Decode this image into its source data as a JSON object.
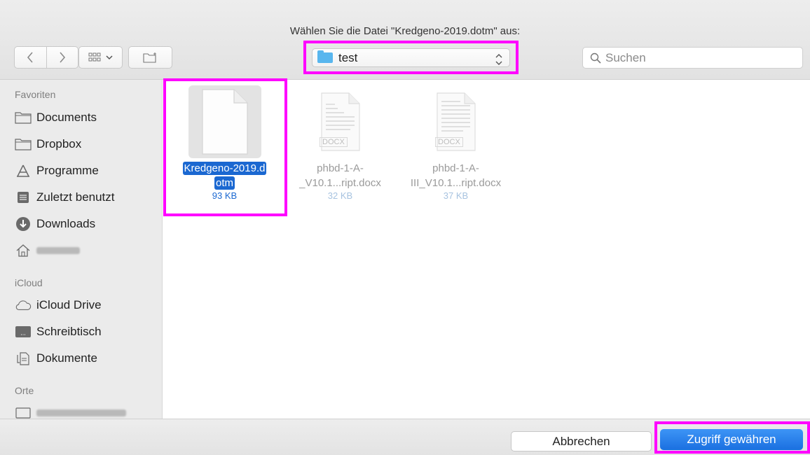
{
  "dialog": {
    "title": "Wählen Sie die Datei \"Kredgeno-2019.dotm\" aus:"
  },
  "toolbar": {
    "back_icon": "chevron-left-icon",
    "forward_icon": "chevron-right-icon",
    "view_icon": "icon-grid-view-icon",
    "new_folder_icon": "new-folder-icon",
    "location": "test",
    "search_placeholder": "Suchen"
  },
  "sidebar": {
    "favorites_header": "Favoriten",
    "favorites": [
      {
        "label": "Documents",
        "icon": "folder-icon"
      },
      {
        "label": "Dropbox",
        "icon": "folder-icon"
      },
      {
        "label": "Programme",
        "icon": "applications-icon"
      },
      {
        "label": "Zuletzt benutzt",
        "icon": "recents-icon"
      },
      {
        "label": "Downloads",
        "icon": "downloads-icon"
      }
    ],
    "icloud_header": "iCloud",
    "icloud": [
      {
        "label": "iCloud Drive",
        "icon": "cloud-icon"
      },
      {
        "label": "Schreibtisch",
        "icon": "desktop-icon"
      },
      {
        "label": "Dokumente",
        "icon": "documents-icon"
      }
    ],
    "places_header": "Orte"
  },
  "files": [
    {
      "name_line1": "Kredgeno-2019.d",
      "name_line2": "otm",
      "size": "93 KB",
      "selected": true,
      "badge": ""
    },
    {
      "name_line1": "phbd-1-A-",
      "name_line2": "_V10.1...ript.docx",
      "size": "32 KB",
      "selected": false,
      "badge": "DOCX"
    },
    {
      "name_line1": "phbd-1-A-",
      "name_line2": "III_V10.1...ript.docx",
      "size": "37 KB",
      "selected": false,
      "badge": "DOCX"
    }
  ],
  "footer": {
    "cancel_label": "Abbrechen",
    "grant_label": "Zugriff gewähren"
  },
  "colors": {
    "highlight": "#ff00ff",
    "accent": "#1b68d1",
    "folder": "#58b6ee"
  }
}
